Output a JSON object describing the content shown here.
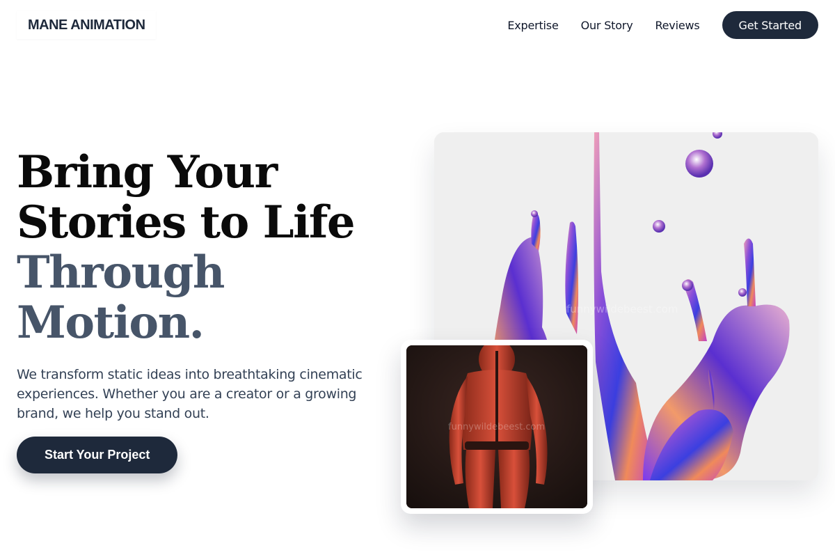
{
  "brand": {
    "name": "MANE ANIMATION"
  },
  "nav": {
    "links": [
      "Expertise",
      "Our Story",
      "Reviews"
    ],
    "cta_label": "Get Started"
  },
  "hero": {
    "headline_line1": "Bring Your",
    "headline_line2": "Stories to Life",
    "headline_line3": "Through",
    "headline_line4": "Motion.",
    "subtext": "We transform static ideas into breathtaking cinematic experiences. Whether you are a creator or a growing brand, we help you stand out.",
    "cta_label": "Start Your Project"
  },
  "media": {
    "main_watermark": "funnywildebeest.com",
    "inset_watermark": "funnywildebeest.com"
  },
  "colors": {
    "primary": "#1e293b",
    "headline_dark": "#0a0a0a",
    "headline_slate": "#475569",
    "body_text": "#334155"
  }
}
